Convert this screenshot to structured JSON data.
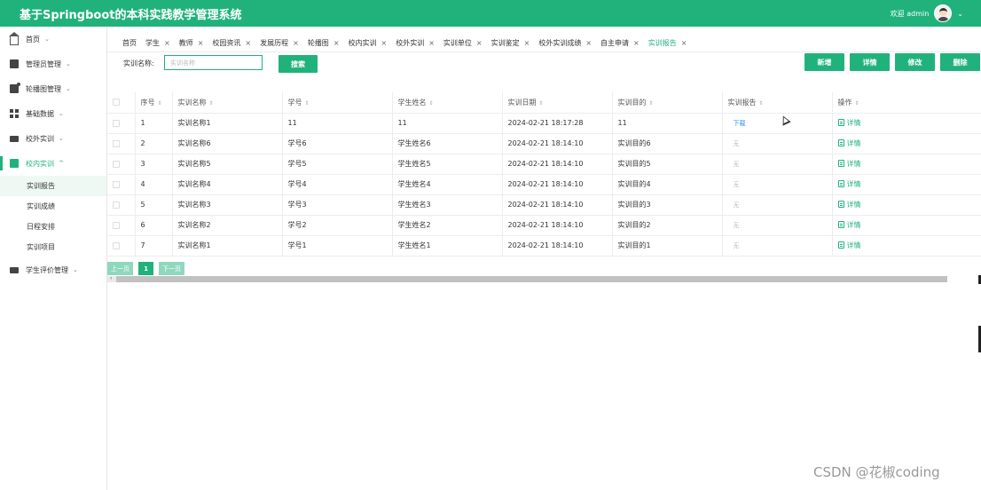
{
  "header": {
    "title": "基于Springboot的本科实践教学管理系统",
    "welcome": "欢迎 admin",
    "caret": "⌄"
  },
  "sidebar": {
    "items": [
      {
        "label": "首页",
        "icon": "home-icon",
        "caret": "⌄"
      },
      {
        "label": "管理员管理",
        "icon": "user-admin-icon",
        "caret": "⌄"
      },
      {
        "label": "轮播图管理",
        "icon": "image-icon",
        "caret": "⌄"
      },
      {
        "label": "基础数据",
        "icon": "grid-icon",
        "caret": "⌄"
      },
      {
        "label": "校外实训",
        "icon": "monitor-icon",
        "caret": "⌄"
      },
      {
        "label": "校内实训",
        "icon": "school-icon",
        "caret": "^"
      },
      {
        "label": "学生评价管理",
        "icon": "monitor-icon",
        "caret": "⌄"
      }
    ],
    "sub_items": [
      "实训报告",
      "实训成绩",
      "日程安排",
      "实训项目"
    ]
  },
  "tabs": [
    {
      "label": "首页",
      "close": ""
    },
    {
      "label": "学生",
      "close": "×"
    },
    {
      "label": "教师",
      "close": "×"
    },
    {
      "label": "校园资讯",
      "close": "×"
    },
    {
      "label": "发展历程",
      "close": "×"
    },
    {
      "label": "轮播图",
      "close": "×"
    },
    {
      "label": "校内实训",
      "close": "×"
    },
    {
      "label": "校外实训",
      "close": "×"
    },
    {
      "label": "实训单位",
      "close": "×"
    },
    {
      "label": "实训鉴定",
      "close": "×"
    },
    {
      "label": "校外实训成绩",
      "close": "×"
    },
    {
      "label": "自主申请",
      "close": "×"
    },
    {
      "label": "实训报告",
      "close": "×"
    }
  ],
  "search": {
    "label": "实训名称:",
    "placeholder": "实训名称",
    "button": "搜索"
  },
  "toolbar": {
    "add": "新增",
    "detail": "详情",
    "edit": "修改",
    "delete": "删除"
  },
  "table": {
    "sort_glyph": "⇕",
    "columns": [
      "序号",
      "实训名称",
      "学号",
      "学生姓名",
      "实训日期",
      "实训目的",
      "实训报告",
      "操作"
    ],
    "download": "下载",
    "none": "无",
    "op": "详情",
    "rows": [
      {
        "no": "1",
        "name": "实训名称1",
        "sid": "11",
        "sname": "11",
        "date": "2024-02-21 18:17:28",
        "purpose": "11",
        "report": "download"
      },
      {
        "no": "2",
        "name": "实训名称6",
        "sid": "学号6",
        "sname": "学生姓名6",
        "date": "2024-02-21 18:14:10",
        "purpose": "实训目的6",
        "report": "none"
      },
      {
        "no": "3",
        "name": "实训名称5",
        "sid": "学号5",
        "sname": "学生姓名5",
        "date": "2024-02-21 18:14:10",
        "purpose": "实训目的5",
        "report": "none"
      },
      {
        "no": "4",
        "name": "实训名称4",
        "sid": "学号4",
        "sname": "学生姓名4",
        "date": "2024-02-21 18:14:10",
        "purpose": "实训目的4",
        "report": "none"
      },
      {
        "no": "5",
        "name": "实训名称3",
        "sid": "学号3",
        "sname": "学生姓名3",
        "date": "2024-02-21 18:14:10",
        "purpose": "实训目的3",
        "report": "none"
      },
      {
        "no": "6",
        "name": "实训名称2",
        "sid": "学号2",
        "sname": "学生姓名2",
        "date": "2024-02-21 18:14:10",
        "purpose": "实训目的2",
        "report": "none"
      },
      {
        "no": "7",
        "name": "实训名称1",
        "sid": "学号1",
        "sname": "学生姓名1",
        "date": "2024-02-21 18:14:10",
        "purpose": "实训目的1",
        "report": "none"
      }
    ]
  },
  "pagination": {
    "prev": "上一页",
    "page": "1",
    "next": "下一页"
  },
  "scroll_arrow": "‹",
  "watermark": "CSDN @花椒coding",
  "colors": {
    "accent": "#21b27c",
    "link": "#2b8ce8"
  }
}
